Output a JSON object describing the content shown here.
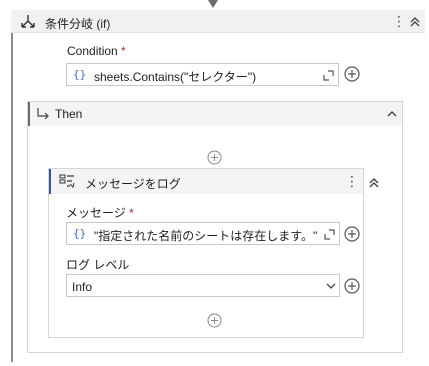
{
  "if_activity": {
    "title": "条件分岐 (if)",
    "condition_label": "Condition",
    "required_mark": "*",
    "condition_value": "sheets.Contains(\"セレクター\")",
    "condition_prefix": "{}"
  },
  "then_branch": {
    "title": "Then"
  },
  "message_activity": {
    "title": "メッセージをログ",
    "message_label": "メッセージ",
    "required_mark": "*",
    "message_prefix": "{}",
    "message_value": "\"指定された名前のシートは存在します。\"",
    "log_level_label": "ログ レベル",
    "log_level_value": "Info"
  },
  "icons": [
    "flow-arrow-icon",
    "if-branch-icon",
    "kebab-icon",
    "chevron-up-icon",
    "expand-icon",
    "plus-circle-icon",
    "then-arrow-icon",
    "log-message-icon",
    "chevron-down-icon",
    "add-activity-icon"
  ],
  "colors": {
    "accent": "#3a6fb7",
    "required": "#b3261e",
    "header_bg": "#f1f1f1"
  }
}
